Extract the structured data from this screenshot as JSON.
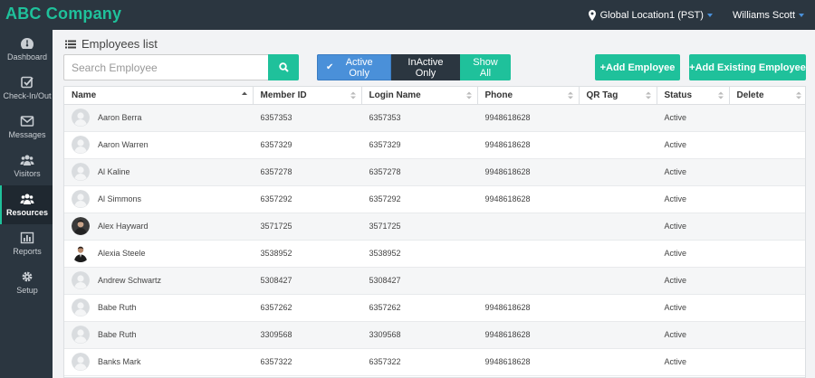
{
  "app": {
    "title": "ABC Company"
  },
  "header": {
    "location": "Global Location1 (PST)",
    "user": "Williams Scott"
  },
  "sidebar": {
    "items": [
      {
        "label": "Dashboard",
        "icon": "dashboard-icon"
      },
      {
        "label": "Check-In/Out",
        "icon": "check-square-icon"
      },
      {
        "label": "Messages",
        "icon": "envelope-icon"
      },
      {
        "label": "Visitors",
        "icon": "users-icon"
      },
      {
        "label": "Resources",
        "icon": "users-icon",
        "active": true
      },
      {
        "label": "Reports",
        "icon": "bar-chart-icon"
      },
      {
        "label": "Setup",
        "icon": "gear-icon"
      }
    ]
  },
  "page": {
    "title": "Employees list"
  },
  "search": {
    "placeholder": "Search Employee"
  },
  "filters": {
    "active_only": "Active Only",
    "inactive_only": "InActive Only",
    "show_all": "Show All"
  },
  "actions": {
    "add_employee": "+Add Employee",
    "add_existing": "+Add Existing Employee"
  },
  "colors": {
    "accent": "#1fc19b",
    "primary": "#4a90d9",
    "dark": "#2b3640"
  },
  "table": {
    "columns": [
      "Name",
      "Member ID",
      "Login Name",
      "Phone",
      "QR Tag",
      "Status",
      "Delete"
    ],
    "rows": [
      {
        "name": "Aaron Berra",
        "member_id": "6357353",
        "login": "6357353",
        "phone": "9948618628",
        "qr": "",
        "status": "Active",
        "avatar": "placeholder"
      },
      {
        "name": "Aaron Warren",
        "member_id": "6357329",
        "login": "6357329",
        "phone": "9948618628",
        "qr": "",
        "status": "Active",
        "avatar": "placeholder"
      },
      {
        "name": "Al Kaline",
        "member_id": "6357278",
        "login": "6357278",
        "phone": "9948618628",
        "qr": "",
        "status": "Active",
        "avatar": "placeholder"
      },
      {
        "name": "Al Simmons",
        "member_id": "6357292",
        "login": "6357292",
        "phone": "9948618628",
        "qr": "",
        "status": "Active",
        "avatar": "placeholder"
      },
      {
        "name": "Alex Hayward",
        "member_id": "3571725",
        "login": "3571725",
        "phone": "",
        "qr": "",
        "status": "Active",
        "avatar": "photo-dark"
      },
      {
        "name": "Alexia Steele",
        "member_id": "3538952",
        "login": "3538952",
        "phone": "",
        "qr": "",
        "status": "Active",
        "avatar": "photo-suit"
      },
      {
        "name": "Andrew Schwartz",
        "member_id": "5308427",
        "login": "5308427",
        "phone": "",
        "qr": "",
        "status": "Active",
        "avatar": "placeholder"
      },
      {
        "name": "Babe Ruth",
        "member_id": "6357262",
        "login": "6357262",
        "phone": "9948618628",
        "qr": "",
        "status": "Active",
        "avatar": "placeholder"
      },
      {
        "name": "Babe Ruth",
        "member_id": "3309568",
        "login": "3309568",
        "phone": "9948618628",
        "qr": "",
        "status": "Active",
        "avatar": "placeholder"
      },
      {
        "name": "Banks Mark",
        "member_id": "6357322",
        "login": "6357322",
        "phone": "9948618628",
        "qr": "",
        "status": "Active",
        "avatar": "placeholder"
      }
    ]
  }
}
